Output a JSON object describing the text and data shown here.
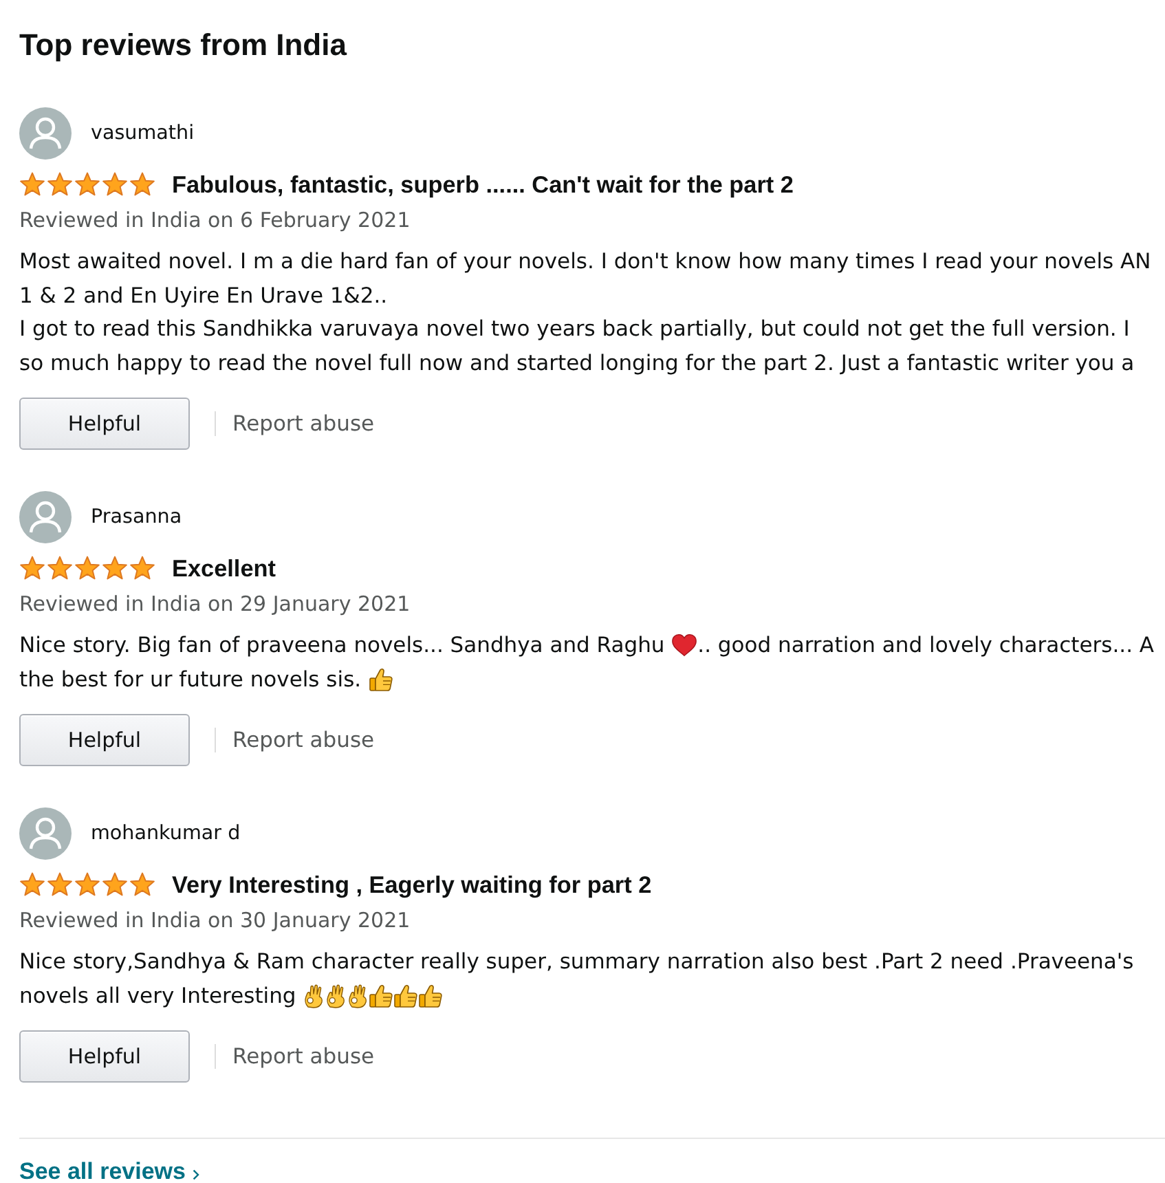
{
  "heading": "Top reviews from India",
  "reviews": [
    {
      "reviewer": "vasumathi",
      "stars": 5,
      "title": "Fabulous, fantastic, superb ...... Can't wait for the part 2",
      "date": "Reviewed in India on 6 February 2021",
      "body": [
        [
          {
            "kind": "text",
            "text": "Most awaited novel. I m a die hard fan of your novels. I don't know how many times I read your novels AN"
          }
        ],
        [
          {
            "kind": "text",
            "text": "1 & 2 and En Uyire En Urave 1&2.."
          }
        ],
        [
          {
            "kind": "text",
            "text": "I got to read this Sandhikka varuvaya novel two years back partially, but could not get the full version. I"
          }
        ],
        [
          {
            "kind": "text",
            "text": "so much happy to read the novel full now and started longing for the part 2. Just a fantastic writer you a"
          }
        ]
      ],
      "helpful": "Helpful",
      "report": "Report abuse"
    },
    {
      "reviewer": "Prasanna",
      "stars": 5,
      "title": "Excellent",
      "date": "Reviewed in India on 29 January 2021",
      "body": [
        [
          {
            "kind": "text",
            "text": "Nice story. Big fan of praveena novels... Sandhya and Raghu "
          },
          {
            "kind": "heart"
          },
          {
            "kind": "text",
            "text": ".. good narration and lovely characters... A"
          }
        ],
        [
          {
            "kind": "text",
            "text": "the best for ur future novels sis. "
          },
          {
            "kind": "thumbsup"
          }
        ]
      ],
      "helpful": "Helpful",
      "report": "Report abuse"
    },
    {
      "reviewer": "mohankumar d",
      "stars": 5,
      "title": "Very Interesting , Eagerly waiting for part 2",
      "date": "Reviewed in India on 30 January 2021",
      "body": [
        [
          {
            "kind": "text",
            "text": "Nice story,Sandhya & Ram character really super, summary narration also best .Part 2 need .Praveena's"
          }
        ],
        [
          {
            "kind": "text",
            "text": "novels all very Interesting "
          },
          {
            "kind": "okhand"
          },
          {
            "kind": "okhand"
          },
          {
            "kind": "okhand"
          },
          {
            "kind": "thumbsup"
          },
          {
            "kind": "thumbsup"
          },
          {
            "kind": "thumbsup"
          }
        ]
      ],
      "helpful": "Helpful",
      "report": "Report abuse"
    }
  ],
  "see_all": "See all reviews"
}
